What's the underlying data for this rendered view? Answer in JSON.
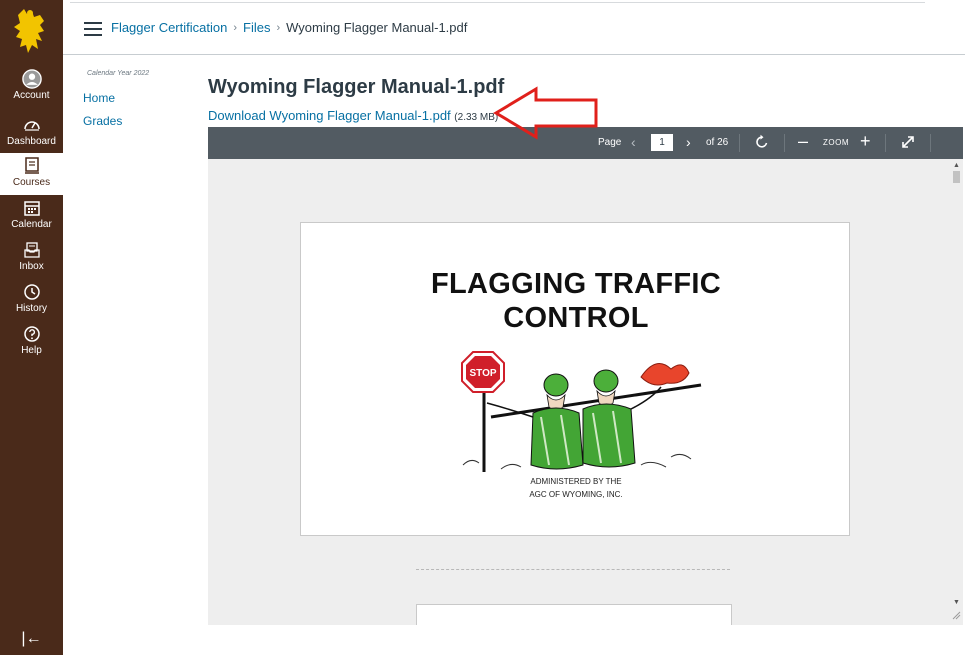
{
  "global_nav": {
    "items": [
      {
        "label": "Account",
        "icon": "account-icon"
      },
      {
        "label": "Dashboard",
        "icon": "dashboard-icon"
      },
      {
        "label": "Courses",
        "icon": "courses-icon"
      },
      {
        "label": "Calendar",
        "icon": "calendar-icon"
      },
      {
        "label": "Inbox",
        "icon": "inbox-icon"
      },
      {
        "label": "History",
        "icon": "history-icon"
      },
      {
        "label": "Help",
        "icon": "help-icon"
      }
    ],
    "active_item": "Courses",
    "collapse_glyph": "|←",
    "brand_color": "#4a2a1a",
    "logo_color": "#f2c400"
  },
  "breadcrumbs": {
    "course": "Flagger Certification",
    "section": "Files",
    "file": "Wyoming Flagger Manual-1.pdf"
  },
  "course_nav": {
    "term": "Calendar Year 2022",
    "links": [
      "Home",
      "Grades"
    ]
  },
  "file": {
    "title": "Wyoming Flagger Manual-1.pdf",
    "download_label": "Download Wyoming Flagger Manual-1.pdf",
    "size": "(2.33 MB)"
  },
  "viewer": {
    "page_label": "Page",
    "current_page": "1",
    "total_pages": "of 26",
    "zoom_label": "ZOOM",
    "toolbar_color": "#525b62"
  },
  "pdf_page": {
    "title_line1": "FLAGGING TRAFFIC",
    "title_line2": "CONTROL",
    "stop_sign": "STOP",
    "admin_line1": "ADMINISTERED  BY THE",
    "admin_line2": "AGC OF WYOMING, INC."
  },
  "annotation": {
    "arrow_color": "#e0201b"
  }
}
